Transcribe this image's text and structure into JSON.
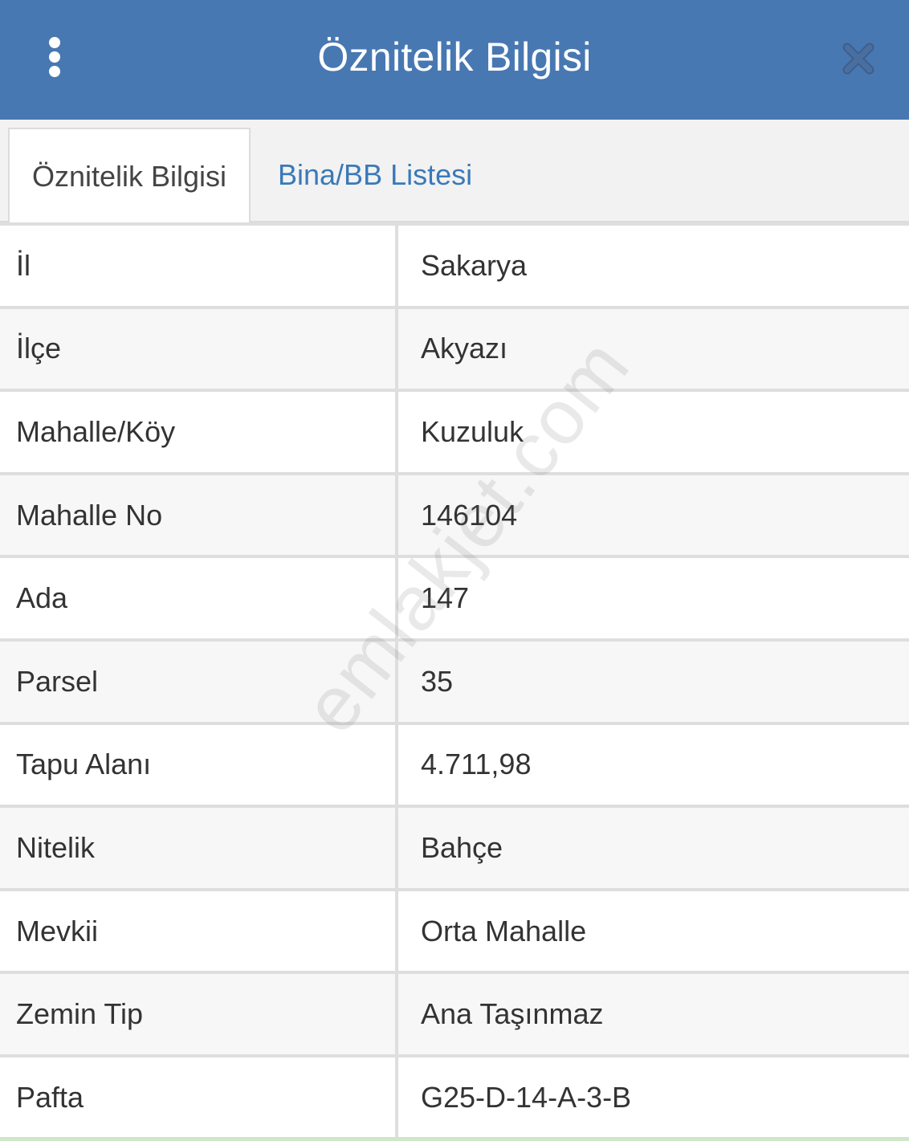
{
  "header": {
    "title": "Öznitelik Bilgisi",
    "menu_icon": "more-vertical-icon",
    "close_icon": "close-icon",
    "background_color": "#4878b2"
  },
  "tabs": [
    {
      "label": "Öznitelik Bilgisi",
      "active": true
    },
    {
      "label": "Bina/BB Listesi",
      "active": false
    }
  ],
  "attributes": [
    {
      "label": "İl",
      "value": "Sakarya"
    },
    {
      "label": "İlçe",
      "value": "Akyazı"
    },
    {
      "label": "Mahalle/Köy",
      "value": "Kuzuluk"
    },
    {
      "label": "Mahalle No",
      "value": "146104"
    },
    {
      "label": "Ada",
      "value": "147"
    },
    {
      "label": "Parsel",
      "value": "35"
    },
    {
      "label": "Tapu Alanı",
      "value": "4.711,98"
    },
    {
      "label": "Nitelik",
      "value": "Bahçe"
    },
    {
      "label": "Mevkii",
      "value": "Orta Mahalle"
    },
    {
      "label": "Zemin Tip",
      "value": "Ana Taşınmaz"
    },
    {
      "label": "Pafta",
      "value": "G25-D-14-A-3-B"
    }
  ],
  "watermark": "emlakjet.com",
  "colors": {
    "tab_link": "#3a79b8",
    "text": "#333333",
    "border": "#dedede"
  }
}
